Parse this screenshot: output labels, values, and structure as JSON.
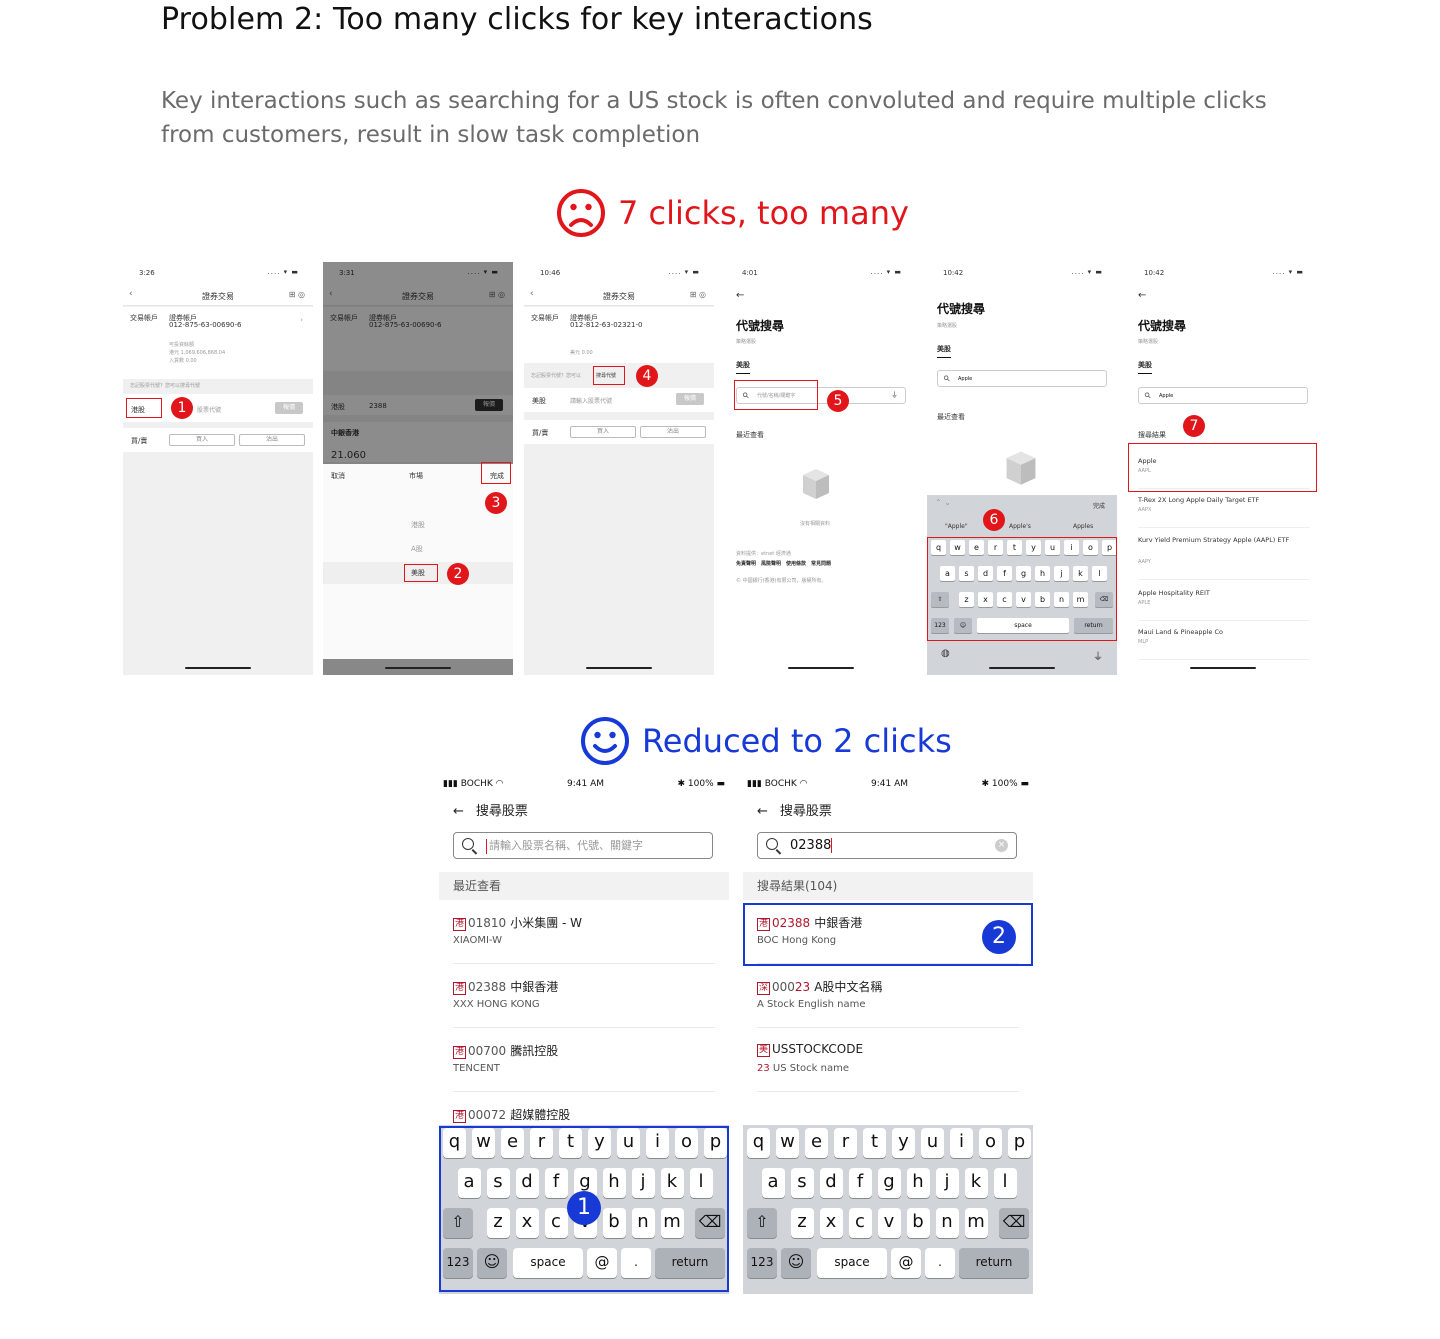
{
  "heading": {
    "title": "Problem 2: Too many clicks for key interactions",
    "description": "Key interactions such as searching for a US stock is often convoluted and require multiple clicks from customers, result in slow task completion"
  },
  "before": {
    "verdict": "7 clicks, too many",
    "accent": "#e0161b",
    "steps": [
      "1",
      "2",
      "3",
      "4",
      "5",
      "6",
      "7"
    ],
    "screen1": {
      "time": "3:26",
      "title": "證券交易",
      "account_label": "交易帳戶",
      "account_name": "證券帳戶",
      "account_no": "012-875-63-00690-6",
      "buying_power_label": "可投資餘額",
      "buying_power": "港元 1,069,606,868.04",
      "bought": "入貨數 0.00",
      "hint": "忘記股票代號？您可以搜尋代號",
      "market": "港股",
      "code_placeholder": "股票代號",
      "quote_btn": "報價",
      "side_label": "買/賣",
      "buy": "買入",
      "sell": "沽出"
    },
    "screen2": {
      "time": "3:31",
      "title": "證券交易",
      "account_label": "交易帳戶",
      "account_name": "證券帳戶",
      "account_no": "012-875-63-00690-6",
      "market": "港股",
      "code": "2388",
      "quote_btn": "報價",
      "stock_name": "中銀香港",
      "picker_cancel": "取消",
      "picker_title": "市場",
      "picker_done": "完成",
      "options": [
        "港股",
        "A股",
        "美股"
      ],
      "price": "21.060"
    },
    "screen3": {
      "time": "10:46",
      "title": "證券交易",
      "account_label": "交易帳戶",
      "account_name": "證券帳戶",
      "account_no": "012-812-63-02321-0",
      "buying_power": "美元 0.00",
      "hint": "忘記股票代號？您可以",
      "search_code": "搜尋代號",
      "market": "美股",
      "code_placeholder": "請輸入股票代號",
      "quote_btn": "報價",
      "side_label": "買/賣",
      "buy": "買入",
      "sell": "沽出"
    },
    "screen4": {
      "time": "4:01",
      "title": "代號搜尋",
      "subtitle": "策略選股",
      "tab": "美股",
      "placeholder": "代號/名稱/關鍵字",
      "recent": "最近查看",
      "empty": "沒有相關資料",
      "source": "資料提供：etnet 經濟通",
      "links": "免責聲明　風險聲明　使用條款　常見問題",
      "copyright": "© 中國銀行(香港)有限公司，版權所有。"
    },
    "screen5": {
      "time": "10:42",
      "title": "代號搜尋",
      "subtitle": "策略選股",
      "tab": "美股",
      "query": "Apple",
      "recent": "最近查看",
      "suggestions": [
        "\"Apple\"",
        "Apple's",
        "Apples"
      ],
      "done": "完成",
      "row1": [
        "q",
        "w",
        "e",
        "r",
        "t",
        "y",
        "u",
        "i",
        "o",
        "p"
      ],
      "row2": [
        "a",
        "s",
        "d",
        "f",
        "g",
        "h",
        "j",
        "k",
        "l"
      ],
      "row3": [
        "z",
        "x",
        "c",
        "v",
        "b",
        "n",
        "m"
      ],
      "num": "123",
      "space": "space",
      "return": "return"
    },
    "screen6": {
      "time": "10:42",
      "title": "代號搜尋",
      "subtitle": "策略選股",
      "tab": "美股",
      "query": "Apple",
      "results_label": "搜尋結果",
      "results": [
        {
          "name": "Apple",
          "code": "AAPL"
        },
        {
          "name": "T-Rex 2X Long Apple Daily Target ETF",
          "code": "AAPX"
        },
        {
          "name": "Kurv Yield Premium Strategy Apple (AAPL) ETF",
          "code": "AAPY"
        },
        {
          "name": "Apple Hospitality REIT",
          "code": "APLE"
        },
        {
          "name": "Maui Land & Pineapple Co",
          "code": "MLP"
        }
      ]
    }
  },
  "after": {
    "verdict": "Reduced to 2 clicks",
    "accent": "#1739d6",
    "steps": [
      "1",
      "2"
    ],
    "status": {
      "carrier": "BOCHK",
      "time": "9:41 AM",
      "battery": "100%"
    },
    "left": {
      "title": "搜尋股票",
      "placeholder": "請輸入股票名稱、代號、關鍵字",
      "section": "最近查看",
      "items": [
        {
          "mkt": "港",
          "code": "01810",
          "name": "小米集團 - W",
          "sub": "XIAOMI-W"
        },
        {
          "mkt": "港",
          "code": "02388",
          "name": "中銀香港",
          "sub": "XXX HONG KONG"
        },
        {
          "mkt": "港",
          "code": "00700",
          "name": "騰訊控股",
          "sub": "TENCENT"
        },
        {
          "mkt": "港",
          "code": "00072",
          "name": "超媒體控股",
          "sub": ""
        }
      ]
    },
    "right": {
      "title": "搜尋股票",
      "query": "02388",
      "section": "搜尋結果(104)",
      "items": [
        {
          "mkt": "港",
          "code": "02388",
          "name": "中銀香港",
          "sub": "BOC Hong Kong"
        },
        {
          "mkt": "深",
          "code_a": "000",
          "code_b": "23",
          "name": "A股中文名稱",
          "sub": "A Stock English name"
        },
        {
          "mkt": "美",
          "name": "USSTOCKCODE",
          "sub_a": "23",
          "sub_b": " US Stock name"
        }
      ]
    },
    "keyboard": {
      "row1": [
        "q",
        "w",
        "e",
        "r",
        "t",
        "y",
        "u",
        "i",
        "o",
        "p"
      ],
      "row2": [
        "a",
        "s",
        "d",
        "f",
        "g",
        "h",
        "j",
        "k",
        "l"
      ],
      "row3": [
        "z",
        "x",
        "c",
        "v",
        "b",
        "n",
        "m"
      ],
      "num": "123",
      "space": "space",
      "at": "@",
      "dot": ".",
      "return": "return"
    }
  }
}
